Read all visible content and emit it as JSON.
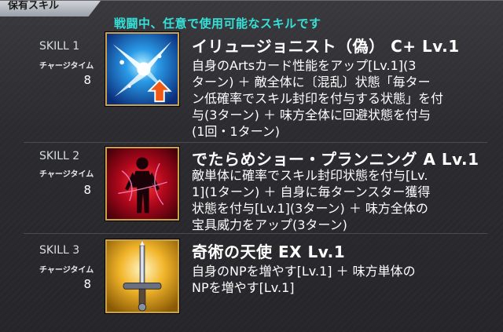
{
  "header": {
    "tab_label": "保有スキル",
    "subtitle": "戦闘中、任意で使用可能なスキルです"
  },
  "skills": [
    {
      "slot": "SKILL 1",
      "charge_label": "チャージタイム",
      "charge_value": "8",
      "icon": "arts-up-sparkle-icon",
      "name": "イリュージョニスト（偽） C+ Lv.1",
      "desc": [
        "自身のArtsカード性能をアップ[Lv.1](3",
        "ターン) ＋ 敵全体に〔混乱〕状態「毎ター",
        "ン低確率でスキル封印を付与する状態」を付",
        "与(3ターン) ＋ 味方全体に回避状態を付与",
        "(1回・1ターン)"
      ]
    },
    {
      "slot": "SKILL 2",
      "charge_label": "チャージタイム",
      "charge_value": "8",
      "icon": "seal-silhouette-icon",
      "name": "でたらめショー・プランニング A Lv.1",
      "desc": [
        "敵単体に確率でスキル封印状態を付与[Lv.",
        "1](1ターン) ＋ 自身に毎ターンスター獲得",
        "状態を付与[Lv.1](3ターン) ＋ 味方全体の",
        "宝具威力をアップ(3ターン)"
      ]
    },
    {
      "slot": "SKILL 3",
      "charge_label": "チャージタイム",
      "charge_value": "8",
      "icon": "sword-np-icon",
      "name": "奇術の天使 EX Lv.1",
      "desc": [
        "自身のNPを増やす[Lv.1] ＋ 味方単体の",
        "NPを増やす[Lv.1]"
      ]
    }
  ]
}
